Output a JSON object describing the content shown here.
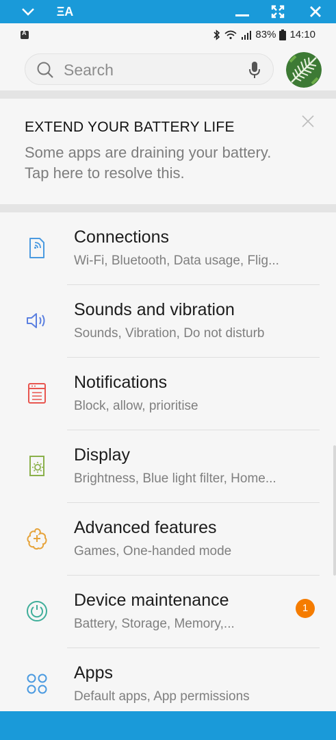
{
  "window_bar": {
    "app_label": "ΞA"
  },
  "status_bar": {
    "battery": "83%",
    "time": "14:10"
  },
  "search": {
    "placeholder": "Search"
  },
  "battery_card": {
    "title": "EXTEND YOUR BATTERY LIFE",
    "body": "Some apps are draining your battery. Tap here to resolve this."
  },
  "settings": {
    "items": [
      {
        "title": "Connections",
        "subtitle": "Wi-Fi, Bluetooth, Data usage, Flig...",
        "icon": "connections-icon",
        "color": "#4a9ae0"
      },
      {
        "title": "Sounds and vibration",
        "subtitle": "Sounds, Vibration, Do not disturb",
        "icon": "sound-icon",
        "color": "#5a7fe0"
      },
      {
        "title": "Notifications",
        "subtitle": "Block, allow, prioritise",
        "icon": "notifications-icon",
        "color": "#e8554f"
      },
      {
        "title": "Display",
        "subtitle": "Brightness, Blue light filter, Home...",
        "icon": "display-icon",
        "color": "#8ab04a"
      },
      {
        "title": "Advanced features",
        "subtitle": "Games, One-handed mode",
        "icon": "advanced-features-icon",
        "color": "#e6a33a"
      },
      {
        "title": "Device maintenance",
        "subtitle": "Battery, Storage, Memory,...",
        "icon": "device-maintenance-icon",
        "color": "#3fae9a",
        "badge": "1"
      },
      {
        "title": "Apps",
        "subtitle": "Default apps, App permissions",
        "icon": "apps-icon",
        "color": "#4a9ae0"
      }
    ]
  },
  "colors": {
    "accent": "#1a9ad9",
    "badge": "#f57c00"
  }
}
